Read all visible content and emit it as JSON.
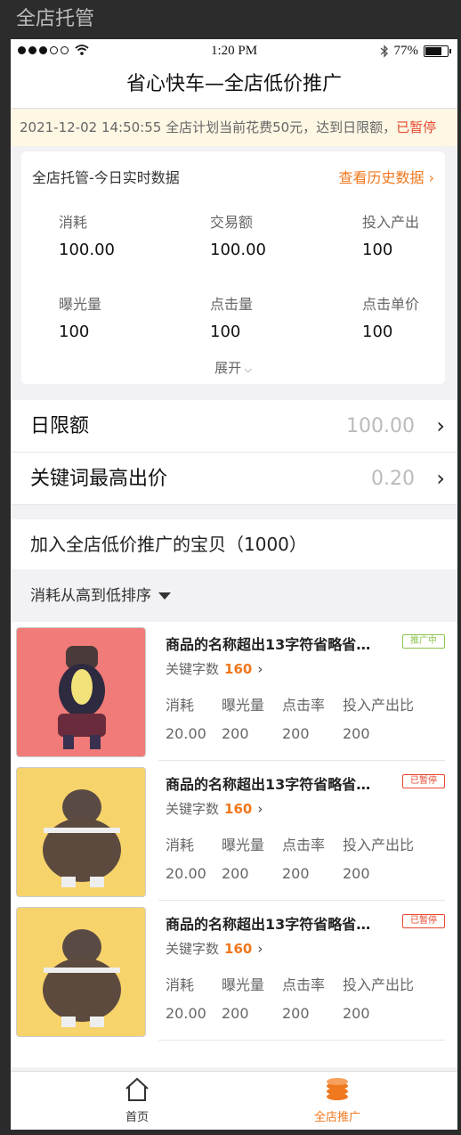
{
  "window_title": "全店托管",
  "status_bar": {
    "time": "1:20 PM",
    "battery": "77%"
  },
  "nav": {
    "title": "省心快车—全店低价推广"
  },
  "notice": {
    "text": "2021-12-02 14:50:55 全店计划当前花费50元，达到日限额，",
    "status": "已暂停"
  },
  "today_card": {
    "title": "全店托管-今日实时数据",
    "history_link": "查看历史数据",
    "metrics": [
      {
        "label": "消耗",
        "value": "100.00"
      },
      {
        "label": "交易额",
        "value": "100.00"
      },
      {
        "label": "投入产出",
        "value": "100"
      },
      {
        "label": "曝光量",
        "value": "100"
      },
      {
        "label": "点击量",
        "value": "100"
      },
      {
        "label": "点击单价",
        "value": "100"
      }
    ],
    "expand": "展开"
  },
  "settings": [
    {
      "label": "日限额",
      "value": "100.00"
    },
    {
      "label": "关键词最高出价",
      "value": "0.20"
    }
  ],
  "products_header": "加入全店低价推广的宝贝（1000）",
  "sort_label": "消耗从高到低排序",
  "stat_labels": [
    "消耗",
    "曝光量",
    "点击率",
    "投入产出比"
  ],
  "keyword_label": "关键字数",
  "products": [
    {
      "name": "商品的名称超出13字符省略省…",
      "status": "推广中",
      "keywords": "160",
      "stats": [
        "20.00",
        "200",
        "200",
        "200"
      ]
    },
    {
      "name": "商品的名称超出13字符省略省…",
      "status": "已暂停",
      "keywords": "160",
      "stats": [
        "20.00",
        "200",
        "200",
        "200"
      ]
    },
    {
      "name": "商品的名称超出13字符省略省…",
      "status": "已暂停",
      "keywords": "160",
      "stats": [
        "20.00",
        "200",
        "200",
        "200"
      ]
    }
  ],
  "tabbar": [
    {
      "label": "首页",
      "icon": "home-icon",
      "active": false
    },
    {
      "label": "全店推广",
      "icon": "coins-icon",
      "active": true
    }
  ],
  "colors": {
    "accent": "#f0781e",
    "paused": "#e84a32",
    "active_badge": "#8cc44c"
  }
}
